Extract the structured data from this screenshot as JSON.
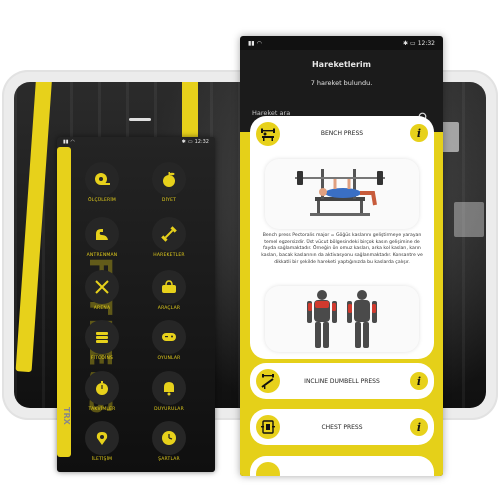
{
  "left_phone": {
    "status_time": "12:32",
    "brand_text": "FITNESS",
    "strap_text": "TRX",
    "menu": [
      {
        "label": "ÖLÇÜLERİM",
        "icon": "tape-measure-icon"
      },
      {
        "label": "DİYET",
        "icon": "apple-icon"
      },
      {
        "label": "ANTRENMAN",
        "icon": "flexing-arm-icon"
      },
      {
        "label": "HAREKETLER",
        "icon": "dumbbell-icon"
      },
      {
        "label": "ARENA",
        "icon": "crossed-swords-icon"
      },
      {
        "label": "ARAÇLAR",
        "icon": "gym-bag-icon"
      },
      {
        "label": "FİTCOİNS",
        "icon": "coins-icon"
      },
      {
        "label": "OYUNLAR",
        "icon": "gamepad-icon"
      },
      {
        "label": "TAKVİMLER",
        "icon": "stopwatch-icon"
      },
      {
        "label": "DUYURULAR",
        "icon": "bell-icon"
      },
      {
        "label": "İLETİŞİM",
        "icon": "map-pin-icon"
      },
      {
        "label": "ŞARTLAR",
        "icon": "clock-icon"
      }
    ]
  },
  "right_phone": {
    "status_time": "12:32",
    "title": "Hareketlerim",
    "count_text": "7 hareket bulundu.",
    "search_placeholder": "Hareket ara",
    "accent": "#e5d019",
    "exercises": [
      {
        "name": "BENCH PRESS",
        "icon": "bench-press-icon",
        "info": "i",
        "description": "Bench press Pectoralis major = Göğüs kaslarını geliştirmeye yarayan temel egzersizdir. Üst vücut bölgesindeki birçok kasın gelişimine de fayda sağlamaktadır. Örneğin ön omuz kasları, arka kol kasları, karın kasları, bacak kaslarının da aktivasyonu sağlanmaktadır. Konsantre ve dikkatli bir şekilde hareketi yaptığınızda bu kaslarda çalışır."
      },
      {
        "name": "INCLINE DUMBELL PRESS",
        "icon": "incline-press-icon",
        "info": "i"
      },
      {
        "name": "CHEST PRESS",
        "icon": "chest-press-machine-icon",
        "info": "i"
      }
    ]
  }
}
